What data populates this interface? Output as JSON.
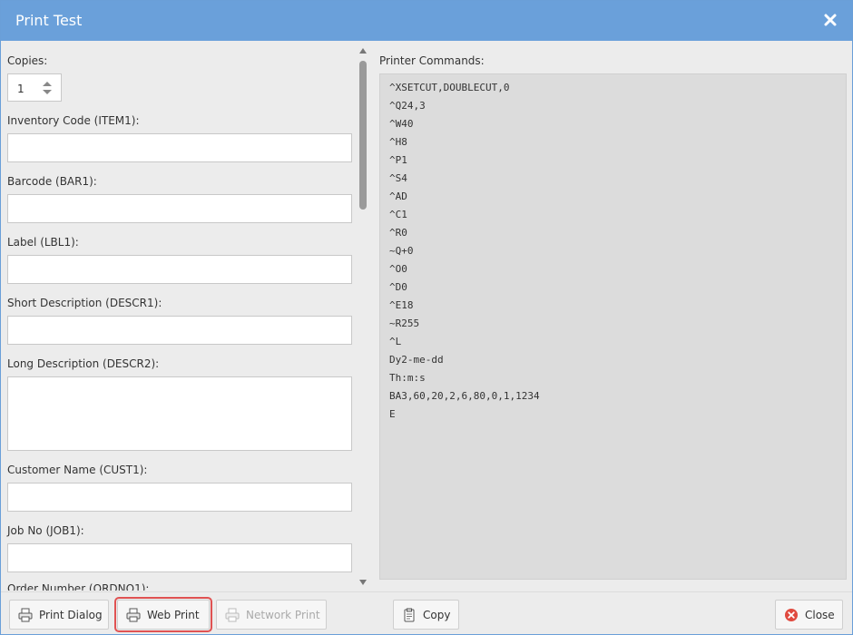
{
  "window": {
    "title": "Print Test"
  },
  "form": {
    "copies": {
      "label": "Copies:",
      "value": "1"
    },
    "fields": [
      {
        "label": "Inventory Code (ITEM1):",
        "value": ""
      },
      {
        "label": "Barcode (BAR1):",
        "value": ""
      },
      {
        "label": "Label (LBL1):",
        "value": ""
      },
      {
        "label": "Short Description (DESCR1):",
        "value": ""
      },
      {
        "label": "Long Description (DESCR2):",
        "value": ""
      },
      {
        "label": "Customer Name (CUST1):",
        "value": ""
      },
      {
        "label": "Job No (JOB1):",
        "value": ""
      },
      {
        "label": "Order Number (ORDNO1):",
        "value": ""
      }
    ]
  },
  "printer_commands": {
    "label": "Printer Commands:",
    "lines": [
      "^XSETCUT,DOUBLECUT,0",
      "^Q24,3",
      "^W40",
      "^H8",
      "^P1",
      "^S4",
      "^AD",
      "^C1",
      "^R0",
      "~Q+0",
      "^O0",
      "^D0",
      "^E18",
      "~R255",
      "^L",
      "Dy2-me-dd",
      "Th:m:s",
      "BA3,60,20,2,6,80,0,1,1234",
      "E"
    ]
  },
  "footer": {
    "print_dialog": "Print Dialog",
    "web_print": "Web Print",
    "network_print": "Network Print",
    "copy": "Copy",
    "close": "Close"
  },
  "colors": {
    "titlebar": "#6aa0da",
    "highlight": "#e05252",
    "close_icon": "#e04a3f"
  },
  "icons": {
    "close": "close-icon",
    "printer": "printer-icon",
    "clipboard": "clipboard-icon",
    "close_circle": "close-circle-icon"
  }
}
